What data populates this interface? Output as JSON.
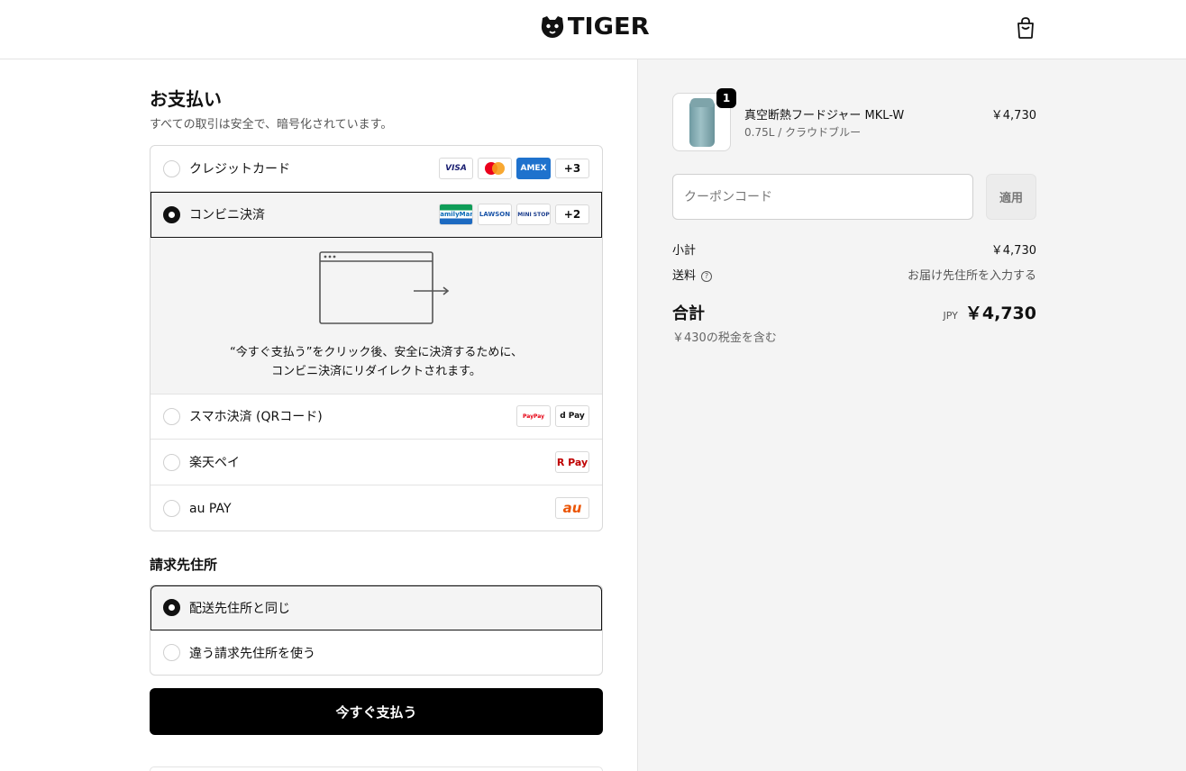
{
  "header": {
    "brand": "TIGER",
    "cart_icon": "shopping-bag-icon"
  },
  "payment": {
    "title": "お支払い",
    "subtitle": "すべての取引は安全で、暗号化されています。",
    "options": [
      {
        "label": "クレジットカード",
        "selected": false,
        "logos": [
          "VISA",
          "Mastercard",
          "AMEX"
        ],
        "more": "+3"
      },
      {
        "label": "コンビニ決済",
        "selected": true,
        "logos": [
          "FamilyMart",
          "LAWSON",
          "MINI STOP"
        ],
        "more": "+2"
      },
      {
        "label": "スマホ決済 (QRコード)",
        "selected": false,
        "logos": [
          "PayPay",
          "d Pay"
        ]
      },
      {
        "label": "楽天ペイ",
        "selected": false,
        "logos": [
          "R Pay"
        ]
      },
      {
        "label": "au PAY",
        "selected": false,
        "logos": [
          "au"
        ]
      }
    ],
    "redirect_line1": "“今すぐ支払う”をクリック後、安全に決済するために、",
    "redirect_line2": "コンビニ決済にリダイレクトされます。"
  },
  "billing": {
    "title": "請求先住所",
    "options": [
      {
        "label": "配送先住所と同じ",
        "selected": true
      },
      {
        "label": "違う請求先住所を使う",
        "selected": false
      }
    ]
  },
  "pay_button": "今すぐ支払う",
  "summary": {
    "product": {
      "quantity": "1",
      "name": "真空断熱フードジャー MKL-W",
      "variant": "0.75L / クラウドブルー",
      "price": "￥4,730"
    },
    "coupon_placeholder": "クーポンコード",
    "apply_label": "適用",
    "subtotal_label": "小計",
    "subtotal_value": "￥4,730",
    "shipping_label": "送料",
    "shipping_value": "お届け先住所を入力する",
    "total_label": "合計",
    "currency": "JPY",
    "total_value": "￥4,730",
    "tax_note": "￥430の税金を含む"
  }
}
